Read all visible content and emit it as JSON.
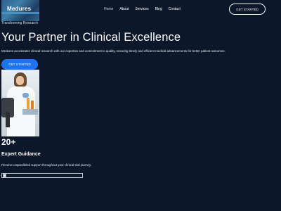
{
  "brand": {
    "logo_text": "Medures",
    "tagline": "Transforming Research"
  },
  "nav": {
    "items": [
      {
        "label": "Home",
        "active": true
      },
      {
        "label": "About",
        "active": false
      },
      {
        "label": "Services",
        "active": false
      },
      {
        "label": "Blog",
        "active": false
      },
      {
        "label": "Contact",
        "active": false
      }
    ],
    "cta_label": "GET STARTED"
  },
  "hero": {
    "title": "Your Partner in Clinical Excellence",
    "subtitle": "Medures accelerates clinical research with our expertise and commitment to quality, ensuring timely and efficient medical advancements for better patient outcomes.",
    "cta_label": "GET STARTED"
  },
  "stat": {
    "number": "20+",
    "title": "Expert Guidance",
    "description": "Receive unparalleled support throughout your clinical trial journey."
  },
  "colors": {
    "background": "#0c1729",
    "accent": "#1a74f0",
    "text": "#ffffff"
  }
}
